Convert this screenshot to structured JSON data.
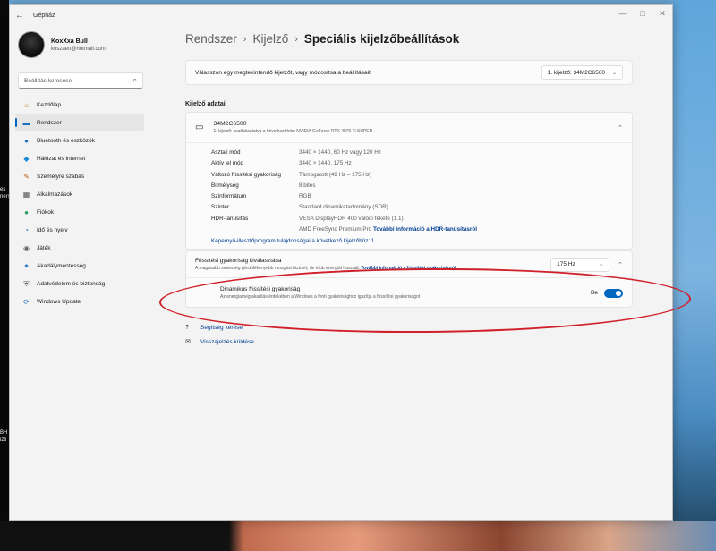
{
  "window": {
    "title": "Gépház"
  },
  "titlebar": {
    "back": "←",
    "minimize": "—",
    "maximize": "□",
    "close": "✕"
  },
  "profile": {
    "name": "KoxXxa Bull",
    "email": "koszaeo@hotmail.com"
  },
  "search": {
    "placeholder": "Beállítás keresése",
    "icon": "⌕"
  },
  "sidebar": {
    "items": [
      {
        "label": "Kezdőlap",
        "icon": "home-icon",
        "glyph": "⌂",
        "color": "#c9822b"
      },
      {
        "label": "Rendszer",
        "icon": "system-icon",
        "glyph": "▬",
        "color": "#1d6fc2",
        "active": true
      },
      {
        "label": "Bluetooth és eszközök",
        "icon": "bluetooth-icon",
        "glyph": "●",
        "color": "#1d6fc2"
      },
      {
        "label": "Hálózat és internet",
        "icon": "network-icon",
        "glyph": "◆",
        "color": "#1d8ad6"
      },
      {
        "label": "Személyre szabás",
        "icon": "brush-icon",
        "glyph": "✎",
        "color": "#c05a1c"
      },
      {
        "label": "Alkalmazások",
        "icon": "apps-icon",
        "glyph": "▦",
        "color": "#555555"
      },
      {
        "label": "Fiókok",
        "icon": "account-icon",
        "glyph": "●",
        "color": "#2a9d5c"
      },
      {
        "label": "Idő és nyelv",
        "icon": "time-language-icon",
        "glyph": "◔",
        "color": "#1d6fc2"
      },
      {
        "label": "Játék",
        "icon": "gaming-icon",
        "glyph": "◉",
        "color": "#666666"
      },
      {
        "label": "Akadálymentesség",
        "icon": "accessibility-icon",
        "glyph": "✦",
        "color": "#1d6fc2"
      },
      {
        "label": "Adatvédelem és biztonság",
        "icon": "shield-icon",
        "glyph": "⛨",
        "color": "#666666"
      },
      {
        "label": "Windows Update",
        "icon": "update-icon",
        "glyph": "⟳",
        "color": "#1d6fc2"
      }
    ]
  },
  "breadcrumb": {
    "items": [
      "Rendszer",
      "Kijelző"
    ],
    "current": "Speciális kijelzőbeállítások",
    "sep": "›"
  },
  "select_display": {
    "label": "Válasszon egy megtekintendő kijelzőt, vagy módosítsa a beállításait",
    "value": "1. kijelző: 34M2C6500",
    "chevron": "⌄"
  },
  "section": {
    "title": "Kijelző adatai"
  },
  "display": {
    "name": "34M2C6500",
    "subtitle": "1. kijelző: csatlakoztatva a következőhöz: NVIDIA GeForce RTX 4070 Ti SUPER",
    "icon": "▭",
    "collapse": "⌃",
    "properties": [
      {
        "key": "Asztali mód",
        "value": "3440 × 1440, 60 Hz vagy 120 Hz"
      },
      {
        "key": "Aktív jel mód",
        "value": "3440 × 1440, 175 Hz"
      },
      {
        "key": "Változó frissítési gyakoriság",
        "value": "Támogatott (49 Hz – 175 Hz)"
      },
      {
        "key": "Bitmélység",
        "value": "8 bites"
      },
      {
        "key": "Színformátum",
        "value": "RGB"
      },
      {
        "key": "Színtér",
        "value": "Standard dinamikatartomány (SDR)"
      },
      {
        "key": "HDR-tanúsítás",
        "value": "VESA DisplayHDR 400 valódi fekete (1.1)"
      }
    ],
    "hdr_line2": "AMD FreeSync Premium Pro",
    "hdr_link": "További információ a HDR-tanúsításról",
    "adapter_link": "Képernyő-illesztőprogram tulajdonságai a következő kijelzőhöz: 1"
  },
  "refresh": {
    "title": "Frissítési gyakoriság kiválasztása",
    "desc": "A magasabb sebesség gördülékenyebb mozgást biztosít, de több energiát használ.",
    "link": "További információ a frissítési gyakoriságról",
    "value": "175 Hz",
    "chevron": "⌄",
    "collapse": "⌃"
  },
  "dynamic": {
    "title": "Dinamikus frissítési gyakoriság",
    "desc": "Az energiamegtakarítás érdekében a Windows a fenti gyakorisághoz igazítja a frissítési gyakoriságot",
    "toggle_label": "Be",
    "toggle_on": true
  },
  "help": {
    "get_help": "Segítség kérése",
    "feedback": "Visszajelzés küldése"
  },
  "desktop": {
    "labels": [
      "es",
      "ners",
      "BH",
      "izti"
    ]
  },
  "colors": {
    "accent": "#0067c0",
    "link": "#003e92",
    "annotation": "#d0202a"
  }
}
